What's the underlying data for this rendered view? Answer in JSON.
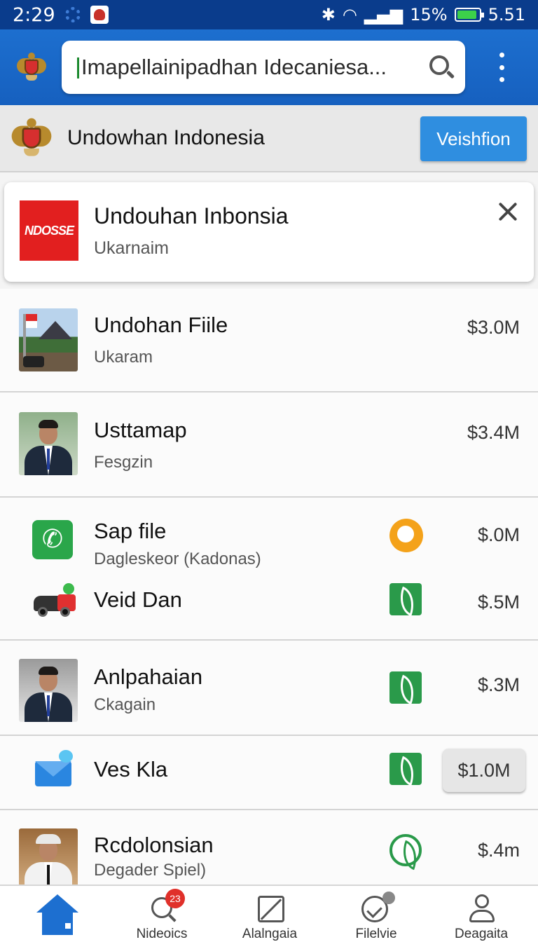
{
  "status_bar": {
    "time": "2:29",
    "battery_text": "15%",
    "clock_right": "5.51",
    "battery_level": 0.8
  },
  "search": {
    "value": "Imapellainipadhan Idecaniesa..."
  },
  "subheader": {
    "title": "Undowhan Indonesia",
    "button_label": "Veishfion"
  },
  "highlight_card": {
    "logo_text": "NDOSSE",
    "title": "Undouhan Inbonsia",
    "subtitle": "Ukarnaim"
  },
  "list": [
    {
      "name": "Undohan Fiile",
      "sub": "Ukaram",
      "price": "$3.0M",
      "thumb": "photo"
    },
    {
      "name": "Usttamap",
      "sub": "Fesgzin",
      "price": "$3.4M",
      "thumb": "person"
    },
    {
      "name": "Sap file",
      "sub": "Dagleskeor (Kadonas)",
      "price": "$.0M",
      "icon": "phone-icon",
      "badge": "chat-icon"
    },
    {
      "name": "Veid Dan",
      "sub": "",
      "price": "$.5M",
      "icon": "car-icon",
      "badge": "leaf-icon"
    },
    {
      "name": "Anlpahaian",
      "sub": "Ckagain",
      "price": "$.3M",
      "thumb": "person",
      "badge": "leaf-icon"
    },
    {
      "name": "Ves Kla",
      "sub": "",
      "price": "$1.0M",
      "icon": "mail-icon",
      "badge": "leaf-icon"
    },
    {
      "name": "Rcdolonsian",
      "sub": "Degader Spiel)",
      "price": "$.4m",
      "thumb": "person",
      "badge": "leaf-round-icon"
    }
  ],
  "bottom_nav": {
    "items": [
      {
        "label": "",
        "icon": "home-icon"
      },
      {
        "label": "Nideoics",
        "icon": "search-icon",
        "badge": "23"
      },
      {
        "label": "Alalngaia",
        "icon": "image-icon"
      },
      {
        "label": "Filelvie",
        "icon": "check-circle-icon"
      },
      {
        "label": "Deagaita",
        "icon": "user-icon"
      }
    ]
  },
  "colors": {
    "header_blue": "#1d6fcf",
    "status_bar": "#0a3c8c",
    "accent_button": "#2f8ee0",
    "leaf_green": "#2a9a4a"
  }
}
